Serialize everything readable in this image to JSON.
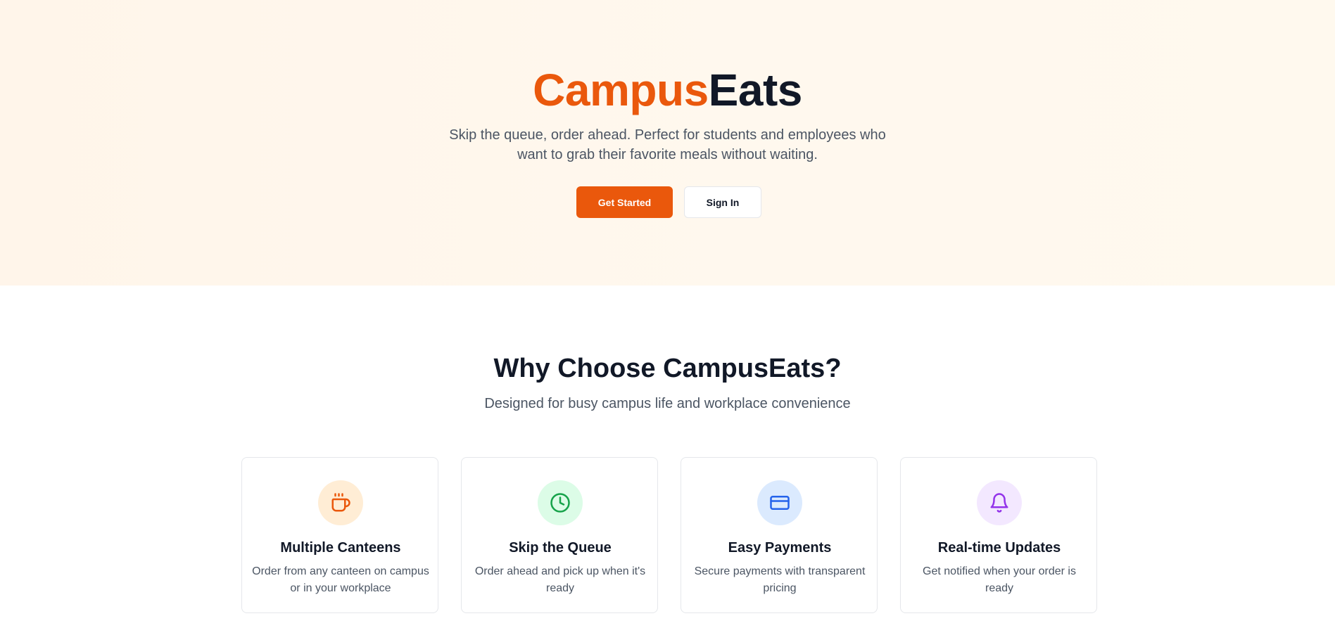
{
  "hero": {
    "brand_part1": "Campus",
    "brand_part2": "Eats",
    "tagline_line1": "Skip the queue, order ahead. Perfect for students and employees who",
    "tagline_line2": "want to grab their favorite meals without waiting.",
    "get_started_label": "Get Started",
    "sign_in_label": "Sign In"
  },
  "features": {
    "title": "Why Choose CampusEats?",
    "subtitle": "Designed for busy campus life and workplace convenience",
    "cards": [
      {
        "icon": "coffee-cup-icon",
        "icon_color": "#ea580c",
        "icon_bg": "#ffedd5",
        "title": "Multiple Canteens",
        "description": "Order from any canteen on campus or in your workplace"
      },
      {
        "icon": "clock-icon",
        "icon_color": "#16a34a",
        "icon_bg": "#dcfce7",
        "title": "Skip the Queue",
        "description": "Order ahead and pick up when it's ready"
      },
      {
        "icon": "credit-card-icon",
        "icon_color": "#2563eb",
        "icon_bg": "#dbeafe",
        "title": "Easy Payments",
        "description": "Secure payments with transparent pricing"
      },
      {
        "icon": "bell-icon",
        "icon_color": "#9333ea",
        "icon_bg": "#f3e8ff",
        "title": "Real-time Updates",
        "description": "Get notified when your order is ready"
      }
    ]
  },
  "colors": {
    "accent": "#ea580c",
    "heading": "#111827",
    "body_text": "#4b5563"
  }
}
